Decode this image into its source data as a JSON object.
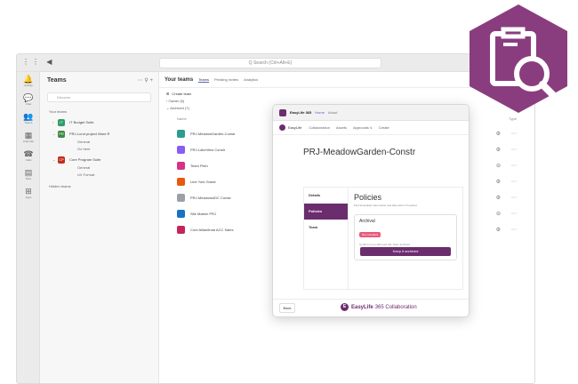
{
  "colors": {
    "accent": "#5b5fc7",
    "brand": "#6b2d6e",
    "archival_badge": "#e85a7a"
  },
  "topbar": {
    "nav_glyphs": "⋮⋮ ◀",
    "search_placeholder": "Q  Search (Ctrl+Alt+E)"
  },
  "rail": {
    "items": [
      {
        "icon": "activity-icon",
        "glyph": "🔔",
        "label": "Activity"
      },
      {
        "icon": "chat-icon",
        "glyph": "💬",
        "label": "Chat"
      },
      {
        "icon": "teams-icon",
        "glyph": "👥",
        "label": "Teams"
      },
      {
        "icon": "calendar-icon",
        "glyph": "▦",
        "label": "Calendar"
      },
      {
        "icon": "calls-icon",
        "glyph": "☎",
        "label": "Calls"
      },
      {
        "icon": "files-icon",
        "glyph": "▤",
        "label": "Files"
      },
      {
        "icon": "apps-icon",
        "glyph": "⊞",
        "label": "Apps"
      }
    ]
  },
  "teams_pane": {
    "title": "Teams",
    "actions": "⋯  ⚲  +",
    "search_placeholder": "Discover",
    "section": "Your teams",
    "teams": [
      {
        "name": "IT Budget Suite",
        "initials": "IT",
        "color": "#2f9e6a"
      },
      {
        "name": "PRJ-Lund project Ware R",
        "initials": "PR",
        "color": "#3f8a45"
      },
      {
        "name": "Core Program Suite",
        "initials": "CP",
        "color": "#c42b1c"
      }
    ],
    "channels_a": [
      "General",
      "Go here"
    ],
    "channels_b": [
      "General",
      "UX Format"
    ],
    "hidden": "Hidden teams"
  },
  "main": {
    "title": "Your teams",
    "tabs": [
      "Teams",
      "Pending invites",
      "Analytics"
    ],
    "corner": "Search",
    "toolbar": "Create team",
    "groups": [
      "Owner (6)",
      "Archived (7)"
    ],
    "col_name": "Name",
    "col_type": "Type",
    "rows": [
      {
        "name": "PRJ-MeadowGarden-Constr",
        "color": "#2a9d8f"
      },
      {
        "name": "PRJ-LakeView Constr",
        "color": "#8a5cf6"
      },
      {
        "name": "Team Pitch",
        "color": "#d63384"
      },
      {
        "name": "Line York Grade",
        "color": "#e8590c"
      },
      {
        "name": "PRJ-MeadowsIDC Constr",
        "color": "#9aa0a6"
      },
      {
        "name": "Site Master PRJ",
        "color": "#1971c2"
      },
      {
        "name": "Core Allianfinda ACC Sales",
        "color": "#c2255c"
      }
    ]
  },
  "dialog": {
    "app_name": "EasyLife 365",
    "tabs": [
      "Home",
      "About"
    ],
    "brand": "EasyLife",
    "nav": [
      "Collaboration",
      "Assets",
      "Approvals ∨",
      "Create"
    ],
    "title": "PRJ-MeadowGarden-Constr",
    "side": [
      "Details",
      "Policies",
      "Team"
    ],
    "policies_title": "Policies",
    "policies_desc": "Find all applied rules below and take action if needed",
    "card_title": "Archival",
    "card_badge": "Not compliant",
    "card_desc": "Confirm if you still need this Team archived",
    "card_button": "Keep it archived",
    "back": "Back",
    "footer_brand": "EasyLife",
    "footer_sub": "365 Collaboration"
  }
}
